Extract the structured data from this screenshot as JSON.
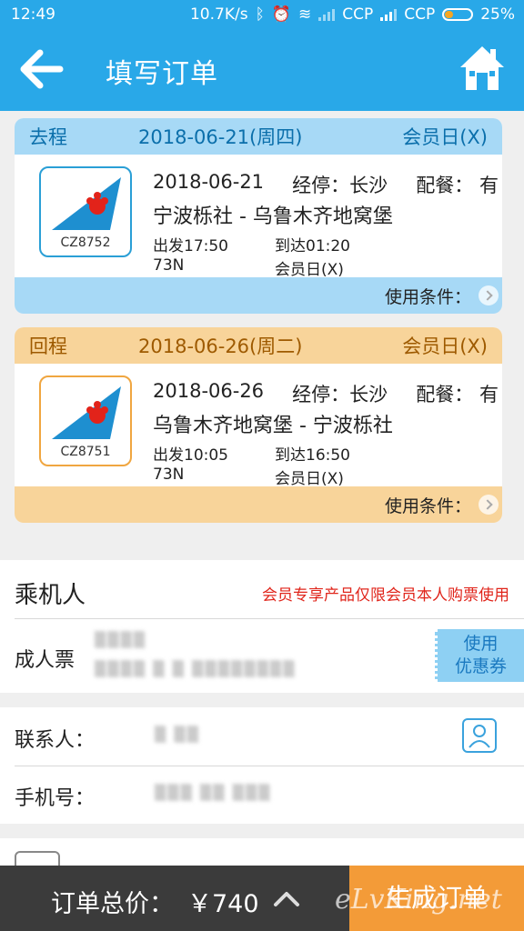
{
  "status": {
    "time": "12:49",
    "speed": "10.7K/s",
    "carrier1": "CCP",
    "carrier2": "CCP",
    "battery": "25%"
  },
  "nav": {
    "title": "填写订单"
  },
  "outbound": {
    "direction": "去程",
    "date": "2018-06-21(周四)",
    "tag": "会员日(X)",
    "flight_no": "CZ8752",
    "detail_date": "2018-06-21",
    "stop": "经停：长沙",
    "meal": "配餐：  有",
    "route": "宁波栎社 - 乌鲁木齐地窝堡",
    "depart": "出发17:50",
    "arrive": "到达01:20",
    "aircraft": "73N",
    "fare": "会员日(X)",
    "conditions": "使用条件："
  },
  "inbound": {
    "direction": "回程",
    "date": "2018-06-26(周二)",
    "tag": "会员日(X)",
    "flight_no": "CZ8751",
    "detail_date": "2018-06-26",
    "stop": "经停：长沙",
    "meal": "配餐：  有",
    "route": "乌鲁木齐地窝堡 - 宁波栎社",
    "depart": "出发10:05",
    "arrive": "到达16:50",
    "aircraft": "73N",
    "fare": "会员日(X)",
    "conditions": "使用条件："
  },
  "passenger": {
    "title": "乘机人",
    "note": "会员专享产品仅限会员本人购票使用",
    "ticket_type": "成人票",
    "coupon_line1": "使用",
    "coupon_line2": "优惠券"
  },
  "contact": {
    "label": "联系人：",
    "phone_label": "手机号："
  },
  "bottom": {
    "total_label": "订单总价：",
    "total_price": "￥740",
    "submit": "生成订单",
    "watermark": "eLvKing.net"
  },
  "colors": {
    "primary": "#29a8e8",
    "outbound_band": "#a7d9f6",
    "inbound_band": "#f8d49a",
    "submit": "#f39b38",
    "warning": "#e0251b"
  }
}
